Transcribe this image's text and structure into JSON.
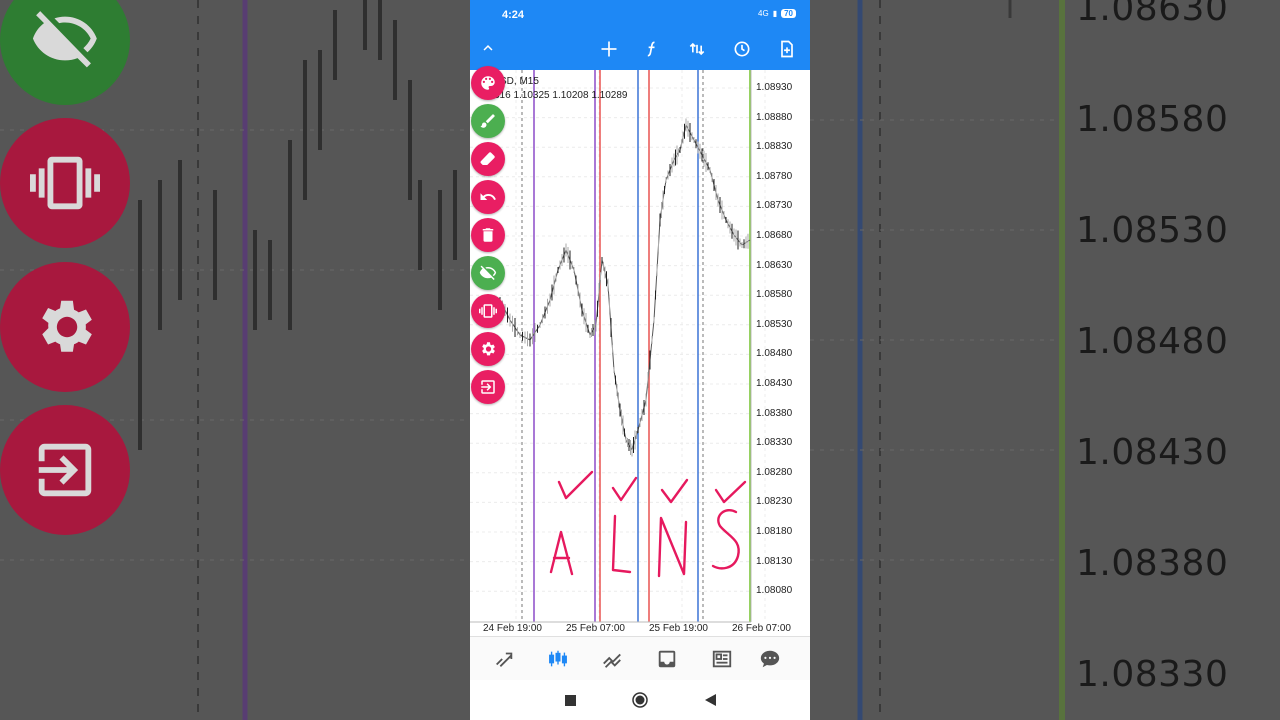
{
  "status_bar": {
    "time": "4:24",
    "network": "4G",
    "battery": "70"
  },
  "toolbar": {
    "collapse_icon": "chevron-up-icon",
    "buttons": [
      "crosshair-icon",
      "function-icon",
      "trade-currency-icon",
      "clock-icon",
      "new-file-icon"
    ]
  },
  "chart": {
    "symbol": "SD, M15",
    "ohlc": "316 1.10325 1.10208 1.10289",
    "price_ticks": [
      "1.08930",
      "1.08880",
      "1.08830",
      "1.08780",
      "1.08730",
      "1.08680",
      "1.08630",
      "1.08580",
      "1.08530",
      "1.08480",
      "1.08430",
      "1.08380",
      "1.08330",
      "1.08280",
      "1.08230",
      "1.08180",
      "1.08130",
      "1.08080"
    ],
    "date_ticks": [
      "24 Feb 19:00",
      "25 Feb 07:00",
      "25 Feb 19:00",
      "26 Feb 07:00"
    ],
    "handwriting": [
      "Á",
      "Ĺ",
      "Ň",
      "Š"
    ],
    "colors": {
      "purple": "#7b2fbf",
      "red": "#e53935",
      "blue": "#1e5fd0",
      "green": "#7cc73a",
      "ink": "#e6195e"
    }
  },
  "side_tools": [
    {
      "name": "palette-icon",
      "color": "#e91e63"
    },
    {
      "name": "brush-icon",
      "color": "#4caf50"
    },
    {
      "name": "eraser-icon",
      "color": "#e91e63"
    },
    {
      "name": "undo-icon",
      "color": "#e91e63"
    },
    {
      "name": "trash-icon",
      "color": "#e91e63"
    },
    {
      "name": "eye-off-icon",
      "color": "#4caf50"
    },
    {
      "name": "vibrate-icon",
      "color": "#e91e63"
    },
    {
      "name": "gear-icon",
      "color": "#e91e63"
    },
    {
      "name": "exit-icon",
      "color": "#e91e63"
    }
  ],
  "bottom_nav": [
    "quotes-icon",
    "chart-icon",
    "trade-icon",
    "history-icon",
    "news-icon",
    "messages-icon"
  ],
  "system_nav": [
    "recents-icon",
    "home-icon",
    "back-icon"
  ],
  "background": {
    "right_prices": [
      "1.08630",
      "1.08580",
      "1.08530",
      "1.08480",
      "1.08430",
      "1.08380",
      "1.08330"
    ]
  }
}
